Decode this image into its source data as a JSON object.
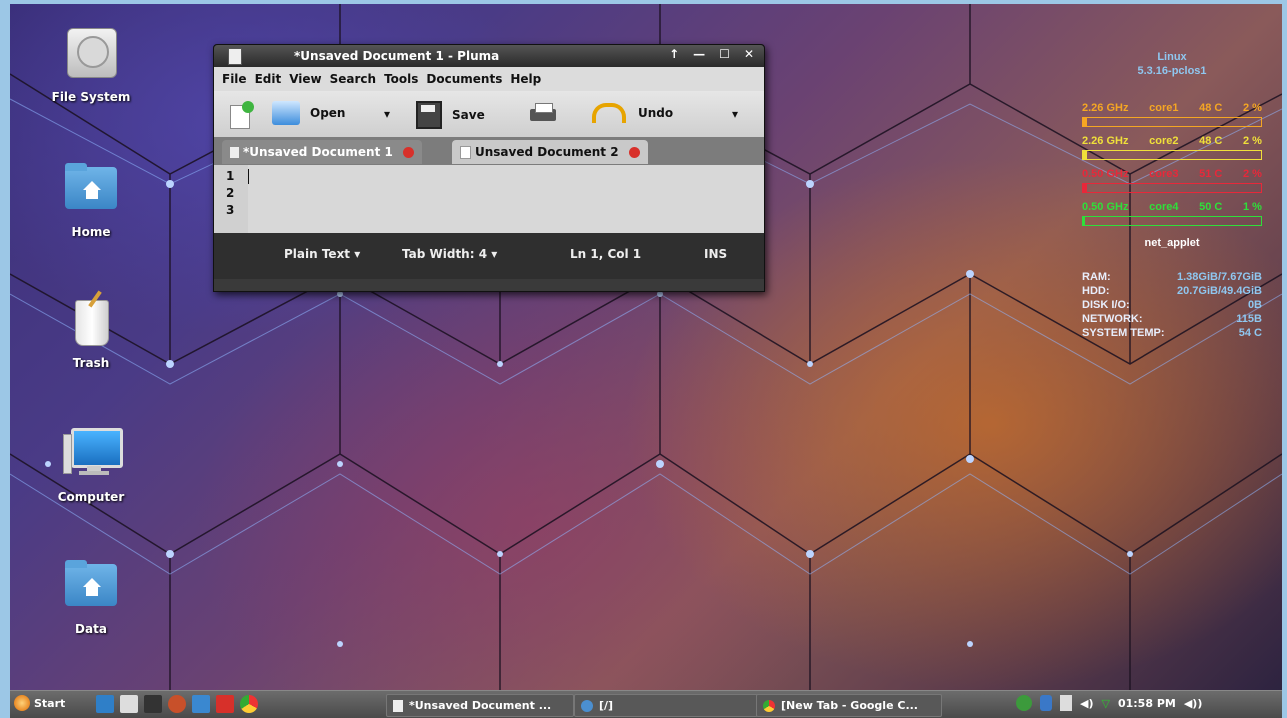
{
  "desktop": {
    "icons": [
      {
        "label": "File System",
        "icon": "harddisk-icon"
      },
      {
        "label": "Home",
        "icon": "home-folder-icon"
      },
      {
        "label": "Trash",
        "icon": "trash-icon"
      },
      {
        "label": "Computer",
        "icon": "computer-icon"
      },
      {
        "label": "Data",
        "icon": "data-folder-icon"
      }
    ]
  },
  "conky": {
    "os": "Linux",
    "kernel": "5.3.16-pclos1",
    "cores": [
      {
        "freq": "2.26 GHz",
        "name": "core1",
        "temp": "48 C",
        "usage": "2 %",
        "color": "#f5a623",
        "fill": 0.02
      },
      {
        "freq": "2.26 GHz",
        "name": "core2",
        "temp": "48 C",
        "usage": "2 %",
        "color": "#f0e03a",
        "fill": 0.02
      },
      {
        "freq": "0.50 GHz",
        "name": "core3",
        "temp": "51 C",
        "usage": "2 %",
        "color": "#e8283a",
        "fill": 0.02
      },
      {
        "freq": "0.50 GHz",
        "name": "core4",
        "temp": "50 C",
        "usage": "1 %",
        "color": "#2ee03a",
        "fill": 0.01
      }
    ],
    "net_applet": "net_applet",
    "stats": [
      {
        "label": "RAM:",
        "value": "1.38GiB/7.67GiB"
      },
      {
        "label": "HDD:",
        "value": "20.7GiB/49.4GiB"
      },
      {
        "label": "DISK I/O:",
        "value": "0B"
      },
      {
        "label": "NETWORK:",
        "value": "115B"
      },
      {
        "label": "SYSTEM TEMP:",
        "value": "54 C"
      }
    ]
  },
  "window": {
    "title": "*Unsaved Document 1 - Pluma",
    "controls": {
      "up": "↑",
      "minimize": "—",
      "maximize": "☐",
      "close": "✕"
    },
    "menu": [
      "File",
      "Edit",
      "View",
      "Search",
      "Tools",
      "Documents",
      "Help"
    ],
    "toolbar": {
      "open": "Open",
      "save": "Save",
      "undo": "Undo"
    },
    "tabs": [
      {
        "label": "*Unsaved Document 1",
        "active": true
      },
      {
        "label": "Unsaved Document 2",
        "active": false
      }
    ],
    "lines": [
      "1",
      "2",
      "3"
    ],
    "status": {
      "language": "Plain Text",
      "tab_width": "Tab Width: 4",
      "position": "Ln 1, Col 1",
      "mode": "INS"
    }
  },
  "taskbar": {
    "start": "Start",
    "tasks": [
      "*Unsaved Document ...",
      "[/]",
      "[New Tab - Google C..."
    ],
    "clock": "01:58 PM"
  }
}
